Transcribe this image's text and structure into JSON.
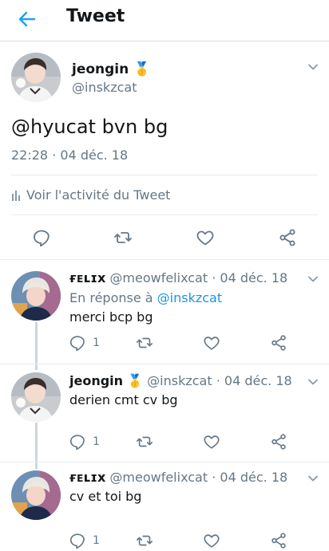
{
  "header": {
    "title": "Tweet"
  },
  "main_tweet": {
    "name": "jeongin",
    "badge_emoji": "🥇",
    "handle": "@inskzcat",
    "text": "@hyucat bvn bg",
    "meta": "22:28 · 04 déc. 18",
    "activity": "Voir l'activité du Tweet"
  },
  "replies": [
    {
      "name": "ғᴇʟɪx",
      "handle": "@meowfelixcat",
      "sep": "·",
      "date": "04 déc. 18",
      "reply_prefix": "En réponse à",
      "reply_to": "@inskzcat",
      "text": "merci bcp bg",
      "reply_count": "1"
    },
    {
      "name": "jeongin",
      "badge_emoji": "🥇",
      "handle": "@inskzcat",
      "sep": "·",
      "date": "04 déc. 18",
      "text": "derien cmt cv bg",
      "reply_count": "1"
    },
    {
      "name": "ғᴇʟɪx",
      "handle": "@meowfelixcat",
      "sep": "·",
      "date": "04 déc. 18",
      "text": "cv et toi bg",
      "reply_count": "1"
    }
  ],
  "colors": {
    "accent": "#1da1f2",
    "link": "#1b95e0",
    "secondary_text": "#657786",
    "thread_line": "#ccd6dd"
  },
  "icons": [
    "back-arrow-icon",
    "chevron-down-icon",
    "bar-chart-icon",
    "reply-icon",
    "retweet-icon",
    "like-icon",
    "share-icon"
  ]
}
